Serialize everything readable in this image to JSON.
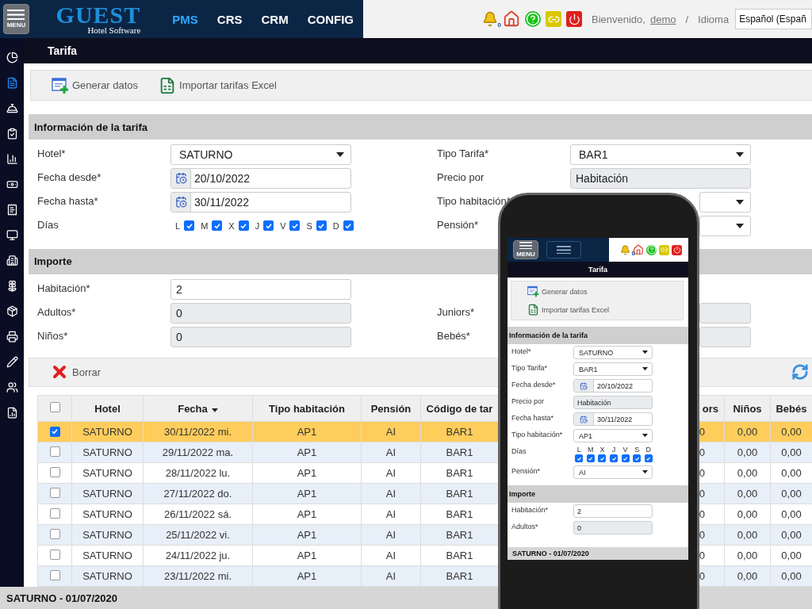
{
  "header": {
    "menu_label": "MENU",
    "logo_title": "GUEST",
    "logo_subtitle": "Hotel Software",
    "nav": [
      {
        "label": "PMS",
        "selected": true
      },
      {
        "label": "CRS",
        "selected": false
      },
      {
        "label": "CRM",
        "selected": false
      },
      {
        "label": "CONFIG",
        "selected": false
      }
    ],
    "notification_count": "0",
    "welcome": "Bienvenido,",
    "user": "demo",
    "separator": "/",
    "language_label": "Idioma",
    "language": "Español (Españ"
  },
  "sidebar": {
    "items": [
      {
        "selected": false
      },
      {
        "selected": true
      },
      {
        "selected": false
      },
      {
        "selected": false
      },
      {
        "selected": false
      },
      {
        "selected": false
      },
      {
        "selected": false
      },
      {
        "selected": false
      },
      {
        "selected": false
      },
      {
        "selected": false
      },
      {
        "selected": false
      },
      {
        "selected": false
      },
      {
        "selected": false
      },
      {
        "selected": false
      },
      {
        "selected": false
      }
    ]
  },
  "page_title": "Tarifa",
  "toolbar": [
    {
      "label": "Generar datos"
    },
    {
      "label": "Importar tarifas Excel"
    }
  ],
  "sections": [
    {
      "title": "Información de la tarifa",
      "rows": [
        {
          "left": {
            "label": "Hotel*",
            "kind": "select",
            "value": "SATURNO"
          },
          "right": {
            "label": "Tipo Tarifa*",
            "kind": "select",
            "value": "BAR1"
          }
        },
        {
          "left": {
            "label": "Fecha desde*",
            "kind": "date",
            "value": "20/10/2022"
          },
          "right": {
            "label": "Precio por",
            "kind": "readonly",
            "value": "Habitación"
          }
        },
        {
          "left": {
            "label": "Fecha hasta*",
            "kind": "date",
            "value": "30/11/2022"
          },
          "right": {
            "label": "Tipo habitación*",
            "kind": "select"
          }
        },
        {
          "left": {
            "label": "Días",
            "kind": "days",
            "days": [
              {
                "label": "L",
                "checked": true
              },
              {
                "label": "M",
                "checked": true
              },
              {
                "label": "X",
                "checked": true
              },
              {
                "label": "J",
                "checked": true
              },
              {
                "label": "V",
                "checked": true
              },
              {
                "label": "S",
                "checked": true
              },
              {
                "label": "D",
                "checked": true
              }
            ]
          },
          "right": {
            "label": "Pensión*",
            "kind": "select"
          }
        }
      ]
    },
    {
      "title": "Importe",
      "rows": [
        {
          "left": {
            "label": "Habitación*",
            "kind": "text",
            "value": "2"
          }
        },
        {
          "left": {
            "label": "Adultos*",
            "kind": "readonly",
            "value": "0"
          },
          "right": {
            "label": "Juniors*",
            "kind": "readonly"
          }
        },
        {
          "left": {
            "label": "Niños*",
            "kind": "readonly",
            "value": "0"
          },
          "right": {
            "label": "Bebés*",
            "kind": "readonly"
          }
        }
      ]
    }
  ],
  "grid_toolbar": {
    "delete_label": "Borrar"
  },
  "table": {
    "header_checked": false,
    "columns": [
      {
        "label": "Hotel",
        "sorted": false
      },
      {
        "label": "Fecha",
        "sorted": true
      },
      {
        "label": "Tipo habitación",
        "sorted": false
      },
      {
        "label": "Pensión",
        "sorted": false
      },
      {
        "label": "Código de tar",
        "sorted": false
      },
      {
        "label": "ors",
        "sorted": false
      },
      {
        "label": "Niños",
        "sorted": false
      },
      {
        "label": "Bebés",
        "sorted": false
      }
    ],
    "rows": [
      {
        "selected": true,
        "cells": [
          "SATURNO",
          "30/11/2022 mi.",
          "AP1",
          "AI",
          "BAR1",
          "0",
          "0,00",
          "0,00"
        ]
      },
      {
        "selected": false,
        "cells": [
          "SATURNO",
          "29/11/2022 ma.",
          "AP1",
          "AI",
          "BAR1",
          "0",
          "0,00",
          "0,00"
        ]
      },
      {
        "selected": false,
        "cells": [
          "SATURNO",
          "28/11/2022 lu.",
          "AP1",
          "AI",
          "BAR1",
          "0",
          "0,00",
          "0,00"
        ]
      },
      {
        "selected": false,
        "cells": [
          "SATURNO",
          "27/11/2022 do.",
          "AP1",
          "AI",
          "BAR1",
          "0",
          "0,00",
          "0,00"
        ]
      },
      {
        "selected": false,
        "cells": [
          "SATURNO",
          "26/11/2022 sá.",
          "AP1",
          "AI",
          "BAR1",
          "0",
          "0,00",
          "0,00"
        ]
      },
      {
        "selected": false,
        "cells": [
          "SATURNO",
          "25/11/2022 vi.",
          "AP1",
          "AI",
          "BAR1",
          "0",
          "0,00",
          "0,00"
        ]
      },
      {
        "selected": false,
        "cells": [
          "SATURNO",
          "24/11/2022 ju.",
          "AP1",
          "AI",
          "BAR1",
          "0",
          "0,00",
          "0,00"
        ]
      },
      {
        "selected": false,
        "cells": [
          "SATURNO",
          "23/11/2022 mi.",
          "AP1",
          "AI",
          "BAR1",
          "0",
          "0,00",
          "0,00"
        ]
      }
    ]
  },
  "status_bar": "SATURNO - 01/07/2020",
  "phone": {
    "menu_label": "MENU",
    "notification_count": "0",
    "title": "Tarifa",
    "toolbar": [
      {
        "label": "Generar datos"
      },
      {
        "label": "Importar tarifas Excel"
      }
    ],
    "sections": [
      {
        "title": "Información de la tarifa",
        "fields": [
          {
            "label": "Hotel*",
            "kind": "select",
            "value": "SATURNO"
          },
          {
            "label": "Tipo Tarifa*",
            "kind": "select",
            "value": "BAR1"
          },
          {
            "label": "Fecha desde*",
            "kind": "date",
            "value": "20/10/2022"
          },
          {
            "label": "Precio por",
            "kind": "readonly",
            "value": "Habitación"
          },
          {
            "label": "Fecha hasta*",
            "kind": "date",
            "value": "30/11/2022"
          },
          {
            "label": "Tipo habitación*",
            "kind": "select",
            "value": "AP1"
          },
          {
            "label": "Días",
            "kind": "days",
            "days": [
              {
                "label": "L",
                "checked": true
              },
              {
                "label": "M",
                "checked": true
              },
              {
                "label": "X",
                "checked": true
              },
              {
                "label": "J",
                "checked": true
              },
              {
                "label": "V",
                "checked": true
              },
              {
                "label": "S",
                "checked": true
              },
              {
                "label": "D",
                "checked": true
              }
            ]
          },
          {
            "label": "Pensión*",
            "kind": "select",
            "value": "AI"
          }
        ]
      },
      {
        "title": "Importe",
        "fields": [
          {
            "label": "Habitación*",
            "kind": "text",
            "value": "2"
          },
          {
            "label": "Adultos*",
            "kind": "readonly",
            "value": "0"
          }
        ]
      }
    ],
    "status_bar": "SATURNO - 01/07/2020"
  }
}
